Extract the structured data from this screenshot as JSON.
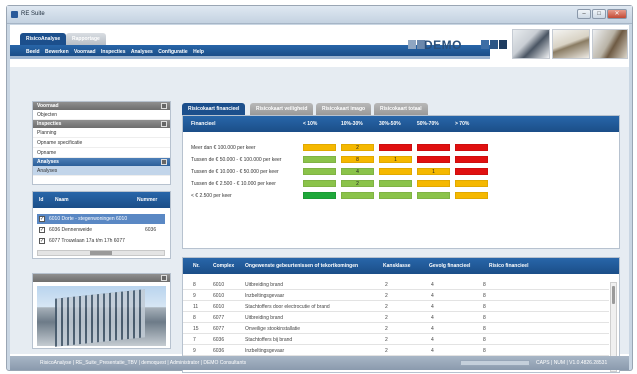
{
  "window": {
    "title": "RE Suite",
    "minimize": "–",
    "maximize": "□",
    "close": "✕"
  },
  "header": {
    "tabs": [
      {
        "label": "RisicoAnalyse"
      },
      {
        "label": "Rapportage"
      }
    ],
    "menu": [
      "Beeld",
      "Bewerken",
      "Voorraad",
      "Inspecties",
      "Analyses",
      "Configuratie",
      "Help"
    ],
    "brand": "DEMO",
    "brand_colors": [
      "#3d6ea5",
      "#2b5585",
      "#1e3c60"
    ]
  },
  "sidebar": {
    "voorraad": {
      "title": "Voorraad",
      "items": [
        "Objecten"
      ]
    },
    "inspecties": {
      "title": "Inspecties",
      "items": [
        "Planning",
        "Opname specificatie",
        "Opname"
      ]
    },
    "analyses": {
      "title": "Analyses",
      "items": [
        "Analyses"
      ]
    },
    "table": {
      "headers": [
        "Id",
        "Naam",
        "Nummer"
      ],
      "rows": [
        {
          "checked": true,
          "naam": "6010 Dorte - stegenwoningen 6010",
          "nummer": "",
          "selected": true
        },
        {
          "checked": true,
          "naam": "6036 Dennenweide",
          "nummer": "6036",
          "selected": false
        },
        {
          "checked": true,
          "naam": "6077 Trouwlaan 17a t/m 17h 6077",
          "nummer": "",
          "selected": false
        }
      ]
    }
  },
  "content": {
    "tabs": [
      "Risicokaart financieel",
      "Risicokaart veiligheid",
      "Risicokaart imago",
      "Risicokaart totaal"
    ],
    "matrix": {
      "header": [
        "Financieel",
        "< 10%",
        "10%-30%",
        "30%-50%",
        "50%-70%",
        "> 70%"
      ],
      "rows": [
        {
          "label": "Meer dan € 100.000 per keer",
          "colors": [
            "#f5b800",
            "#f5b800",
            "#e01010",
            "#e01010",
            "#e01010"
          ],
          "values": [
            "",
            "2",
            "",
            "",
            ""
          ]
        },
        {
          "label": "Tussen de € 50.000 - € 100.000 per keer",
          "colors": [
            "#8bc34a",
            "#f5b800",
            "#f5b800",
            "#e01010",
            "#e01010"
          ],
          "values": [
            "",
            "8",
            "1",
            "",
            ""
          ]
        },
        {
          "label": "Tussen de € 10.000 - € 50.000 per keer",
          "colors": [
            "#8bc34a",
            "#8bc34a",
            "#f5b800",
            "#f5b800",
            "#e01010"
          ],
          "values": [
            "",
            "4",
            "",
            "1",
            ""
          ]
        },
        {
          "label": "Tussen de € 2.500 - € 10.000 per keer",
          "colors": [
            "#8bc34a",
            "#8bc34a",
            "#8bc34a",
            "#f5b800",
            "#f5b800"
          ],
          "values": [
            "",
            "2",
            "",
            "",
            ""
          ]
        },
        {
          "label": "< € 2.500 per keer",
          "colors": [
            "#1ea83a",
            "#8bc34a",
            "#8bc34a",
            "#8bc34a",
            "#f5b800"
          ],
          "values": [
            "",
            "",
            "",
            "",
            ""
          ]
        }
      ]
    },
    "table": {
      "headers": [
        "Nr.",
        "Complex",
        "Ongewenste gebeurtenissen of tekortkomingen",
        "Kansklasse",
        "Gevolg financieel",
        "Risico financieel"
      ],
      "rows": [
        [
          "8",
          "6010",
          "Uitbreiding brand",
          "2",
          "4",
          "8"
        ],
        [
          "9",
          "6010",
          "Inzbeltingsgevaar",
          "2",
          "4",
          "8"
        ],
        [
          "11",
          "6010",
          "Stachtoffers door electrocutie of brand",
          "2",
          "4",
          "8"
        ],
        [
          "8",
          "6077",
          "Uitbreiding brand",
          "2",
          "4",
          "8"
        ],
        [
          "15",
          "6077",
          "Onveilige stookinstallatie",
          "2",
          "4",
          "8"
        ],
        [
          "7",
          "6036",
          "Stachtoffers bij brand",
          "2",
          "4",
          "8"
        ],
        [
          "9",
          "6036",
          "Inzbeltingsgevaar",
          "2",
          "4",
          "8"
        ],
        [
          "11",
          "6036",
          "Stachtoffers door electrocutie of brand",
          "2",
          "4",
          "8"
        ]
      ]
    }
  },
  "statusbar": {
    "left": "RisicoAnalyse | RE_Suite_Presentatie_TBV | demoquest | Administrator | DEMO Consultants",
    "right": "CAPS | NUM | V1.0.4826.28531"
  }
}
